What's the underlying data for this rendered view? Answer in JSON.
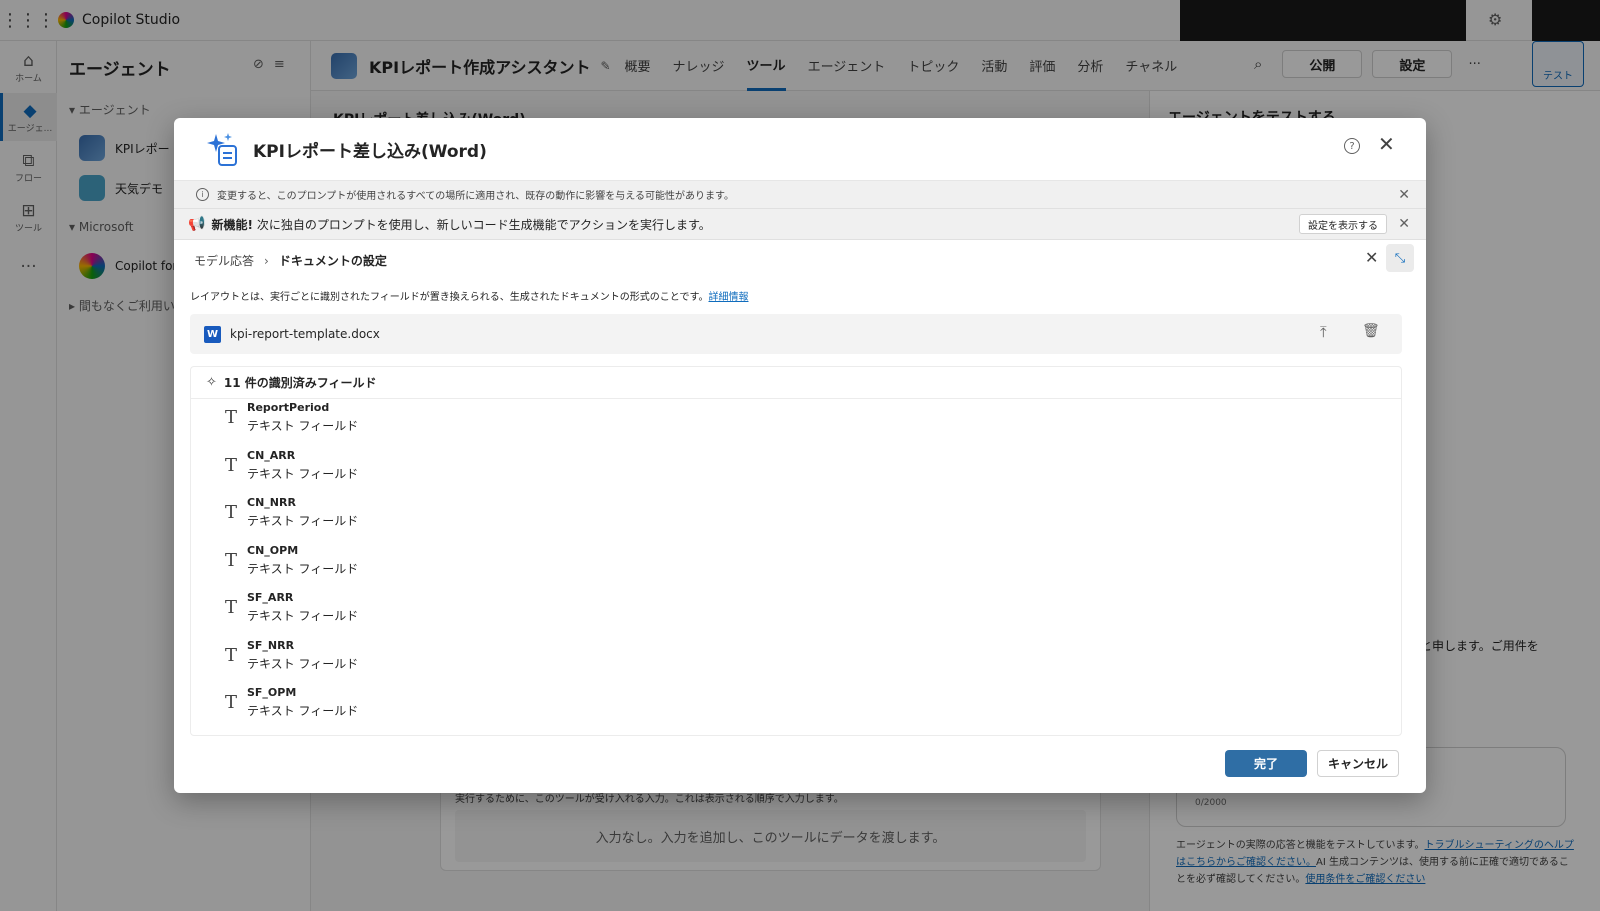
{
  "app": {
    "name": "Copilot Studio"
  },
  "rail": {
    "items": [
      {
        "icon": "home-icon",
        "glyph": "⌂",
        "label": "ホーム"
      },
      {
        "icon": "agent-icon",
        "glyph": "◆",
        "label": "エージェ..."
      },
      {
        "icon": "flow-icon",
        "glyph": "⧉",
        "label": "フロー"
      },
      {
        "icon": "tools-icon",
        "glyph": "⊞",
        "label": "ツール"
      },
      {
        "icon": "more-icon",
        "glyph": "···",
        "label": ""
      }
    ]
  },
  "agent_panel": {
    "title": "エージェント",
    "section_agents": "▾ エージェント",
    "agents": [
      "KPIレポー",
      "天気デモ"
    ],
    "section_ms": "▾ Microsoft",
    "ms_items": [
      "Copilot for"
    ],
    "section_soon": "▸ 間もなくご利用い"
  },
  "header": {
    "agent_title": "KPIレポート作成アシスタント",
    "tabs": [
      "概要",
      "ナレッジ",
      "ツール",
      "エージェント",
      "トピック",
      "活動",
      "評価",
      "分析",
      "チャネル"
    ],
    "active_tab": "ツール",
    "publish": "公開",
    "settings": "設定",
    "more": "···",
    "test": "テスト"
  },
  "center_bg": {
    "title": "KPIレポート差し込み(Word)",
    "inputs_desc": "実行するために、このツールが受け入れる入力。これは表示される順序で入力します。",
    "inputs_empty": "入力なし。入力を追加し、このツールにデータを渡します。"
  },
  "right_panel": {
    "title": "エージェントをテストする",
    "message_fragment": "と申します。ご用件を",
    "char_count": "0/2000",
    "footer_text": "エージェントの実際の応答と機能をテストしています。",
    "footer_link1": "トラブルシューティングのヘルプはこちらからご確認ください。",
    "footer_text2": "AI 生成コンテンツは、使用する前に正確で適切であることを必ず確認してください。",
    "footer_link2": "使用条件をご確認ください"
  },
  "dialog": {
    "title": "KPIレポート差し込み(Word)",
    "info_bar": "変更すると、このプロンプトが使用されるすべての場所に適用され、既存の動作に影響を与える可能性があります。",
    "new_feature_label": "新機能!",
    "new_feature_text": "次に独自のプロンプトを使用し、新しいコード生成機能でアクションを実行します。",
    "show_settings": "設定を表示する",
    "breadcrumb": {
      "parent": "モデル応答",
      "current": "ドキュメントの設定"
    },
    "description": "レイアウトとは、実行ごとに識別されたフィールドが置き換えられる、生成されたドキュメントの形式のことです。",
    "learn_more": "詳細情報",
    "file_name": "kpi-report-template.docx",
    "fields_title": "11 件の識別済みフィールド",
    "fields": [
      {
        "name": "ReportPeriod",
        "type": "テキスト フィールド"
      },
      {
        "name": "CN_ARR",
        "type": "テキスト フィールド"
      },
      {
        "name": "CN_NRR",
        "type": "テキスト フィールド"
      },
      {
        "name": "CN_OPM",
        "type": "テキスト フィールド"
      },
      {
        "name": "SF_ARR",
        "type": "テキスト フィールド"
      },
      {
        "name": "SF_NRR",
        "type": "テキスト フィールド"
      },
      {
        "name": "SF_OPM",
        "type": "テキスト フィールド"
      }
    ],
    "done": "完了",
    "cancel": "キャンセル"
  },
  "colors": {
    "accent": "#0f6cbd",
    "primary_button": "#2f6ea5",
    "word_blue": "#185abd"
  }
}
